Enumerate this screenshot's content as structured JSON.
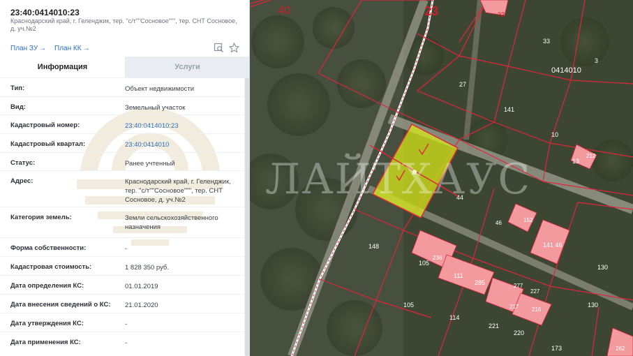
{
  "header": {
    "cadastral_title": "23:40:0414010:23",
    "address_subtitle": "Краснодарский край, г. Геленджик, тер. \"с/т\"\"Сосновое\"\"\", тер. СНТ Сосновое, д. уч.№2",
    "plan_zu": "План ЗУ",
    "plan_kk": "План КК"
  },
  "tabs": {
    "info": "Информация",
    "services": "Услуги"
  },
  "rows": [
    {
      "label": "Тип:",
      "value": "Объект недвижимости"
    },
    {
      "label": "Вид:",
      "value": "Земельный участок"
    },
    {
      "label": "Кадастровый номер:",
      "value": "23:40:0414010:23"
    },
    {
      "label": "Кадастровый квартал:",
      "value": "23:40:0414010"
    },
    {
      "label": "Статус:",
      "value": "Ранее учтенный"
    },
    {
      "label": "Адрес:",
      "value": "Краснодарский край, г. Геленджик, тер. \"с/т\"\"Сосновое\"\"\", тер. СНТ Сосновое, д. уч.№2"
    },
    {
      "label": "Категория земель:",
      "value": "Земли сельскохозяйственного назначения"
    },
    {
      "label": "Форма собственности:",
      "value": "-"
    },
    {
      "label": "Кадастровая стоимость:",
      "value": "1 828 350 руб."
    },
    {
      "label": "Дата определения КС:",
      "value": "01.01.2019"
    },
    {
      "label": "Дата внесения сведений о КС:",
      "value": "21.01.2020"
    },
    {
      "label": "Дата утверждения КС:",
      "value": "-"
    },
    {
      "label": "Дата применения КС:",
      "value": "-"
    }
  ],
  "map": {
    "watermark": "ЛАЙТХАУС",
    "labels": {
      "l40": "40",
      "l23": "23",
      "l22": "22",
      "l33": "33",
      "l3": "3",
      "block": "0414010",
      "l27": "27",
      "l141": "141",
      "l10": "10",
      "l13": "13",
      "l212": "212",
      "l23b": "23",
      "l44": "44",
      "l46": "46",
      "l152": "152",
      "l141b": "141 46",
      "l148": "148",
      "l236": "236",
      "l105": "105",
      "l111": "111",
      "l285": "285",
      "l130": "130",
      "l277": "277",
      "l227": "227",
      "l217": "217",
      "l216": "216",
      "l105b": "105",
      "l114": "114",
      "l221": "221",
      "l220": "220",
      "l130b": "130",
      "l173": "173",
      "l262": "262"
    }
  },
  "colors": {
    "link": "#2a6fbd",
    "parcel_line": "#e0263a",
    "selected_parcel": "#d7e81a",
    "building": "#f29a9e"
  }
}
